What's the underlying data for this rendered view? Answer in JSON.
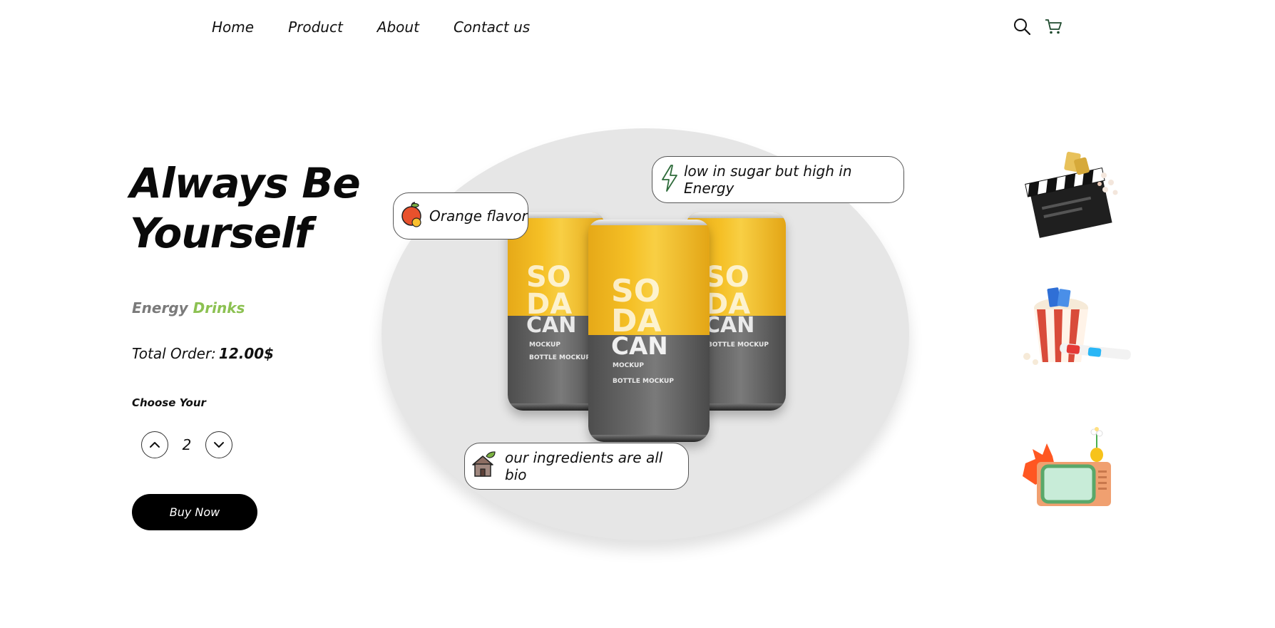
{
  "nav": {
    "items": [
      "Home",
      "Product",
      "About",
      "Contact us"
    ],
    "icons": [
      "search-icon",
      "cart-icon"
    ]
  },
  "hero": {
    "title": "Always Be Yourself",
    "subtitle_word1": "Energy",
    "subtitle_word2": "Drinks",
    "total_label": "Total Order:",
    "total_value": "12.00$",
    "choose_label": "Choose Your",
    "quantity": "2",
    "buy_label": "Buy Now"
  },
  "product": {
    "can_brand_line1": "SO",
    "can_brand_line2": "DA",
    "can_brand_line3": "CAN",
    "can_sub": "MOCKUP",
    "can_sub2": "BOTTLE MOCKUP"
  },
  "features": {
    "orange": "Orange flavor",
    "energy": "low in sugar but high in Energy",
    "bio": "our ingredients are all bio"
  },
  "side_icons": [
    "clapperboard-icon",
    "popcorn-icon",
    "retro-tv-icon"
  ],
  "colors": {
    "accent_green": "#8cc152",
    "button_bg": "#000000",
    "blob_bg": "#e6e6e6"
  }
}
